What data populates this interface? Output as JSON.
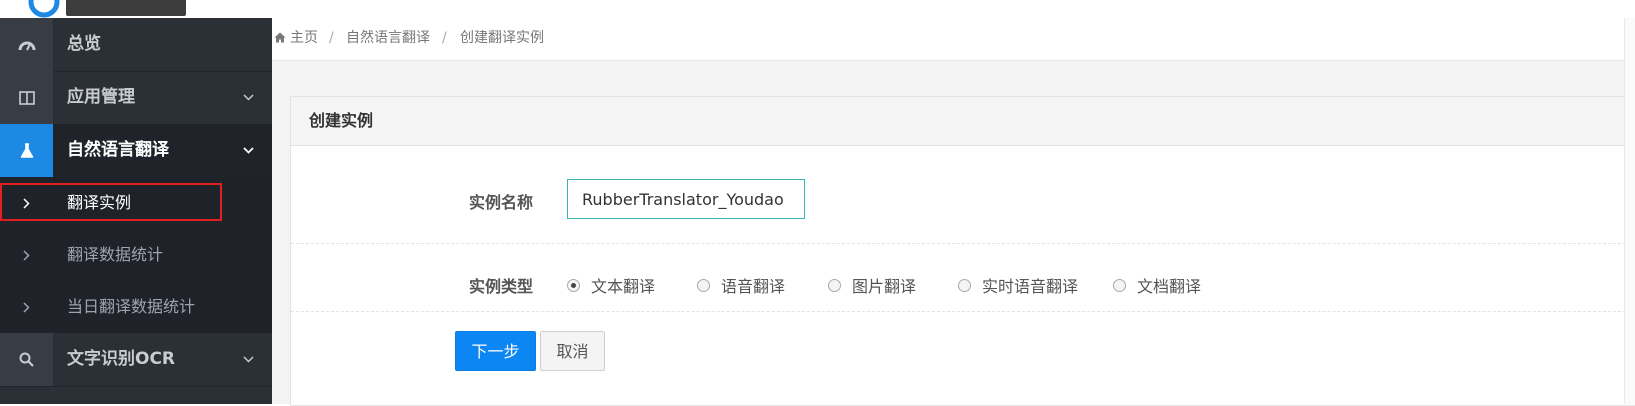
{
  "sidebar": {
    "items": [
      {
        "label": "总览",
        "icon": "dashboard-icon"
      },
      {
        "label": "应用管理",
        "icon": "columns-icon"
      },
      {
        "label": "自然语言翻译",
        "icon": "flask-icon"
      },
      {
        "label": "文字识别OCR",
        "icon": "search-icon"
      }
    ],
    "sub_items": [
      {
        "label": "翻译实例"
      },
      {
        "label": "翻译数据统计"
      },
      {
        "label": "当日翻译数据统计"
      }
    ]
  },
  "breadcrumb": {
    "home": "主页",
    "section": "自然语言翻译",
    "current": "创建翻译实例",
    "separator": "/"
  },
  "panel": {
    "title": "创建实例",
    "name_label": "实例名称",
    "name_value": "RubberTranslator_Youdao",
    "type_label": "实例类型",
    "types": [
      "文本翻译",
      "语音翻译",
      "图片翻译",
      "实时语音翻译",
      "文档翻译"
    ],
    "selected_type": "文本翻译",
    "next_label": "下一步",
    "cancel_label": "取消"
  },
  "colors": {
    "accent": "#0b86f2",
    "sidebar_bg": "#2b2f36",
    "highlight_box": "#e0201e"
  }
}
